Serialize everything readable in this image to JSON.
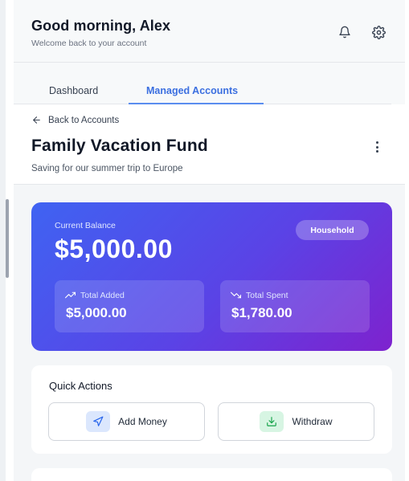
{
  "header": {
    "greeting": "Good morning, Alex",
    "subtitle": "Welcome back to your account",
    "icons": [
      "bell-icon",
      "gear-icon"
    ]
  },
  "tabs": [
    {
      "label": "Dashboard",
      "active": false
    },
    {
      "label": "Managed Accounts",
      "active": true
    }
  ],
  "account": {
    "back_label": "Back to Accounts",
    "title": "Family Vacation Fund",
    "description": "Saving for our summer trip to Europe"
  },
  "balance": {
    "label": "Current Balance",
    "amount": "$5,000.00",
    "badge": "Household",
    "total_added_label": "Total Added",
    "total_added_value": "$5,000.00",
    "total_spent_label": "Total Spent",
    "total_spent_value": "$1,780.00"
  },
  "quick_actions": {
    "title": "Quick Actions",
    "add_money_label": "Add Money",
    "withdraw_label": "Withdraw"
  },
  "colors": {
    "accent": "#3b6fe0",
    "card_gradient_start": "#3f63f2",
    "card_gradient_end": "#7e22ce",
    "add_icon_bg": "#dbe7fd",
    "withdraw_icon_bg": "#d7f5e3"
  }
}
